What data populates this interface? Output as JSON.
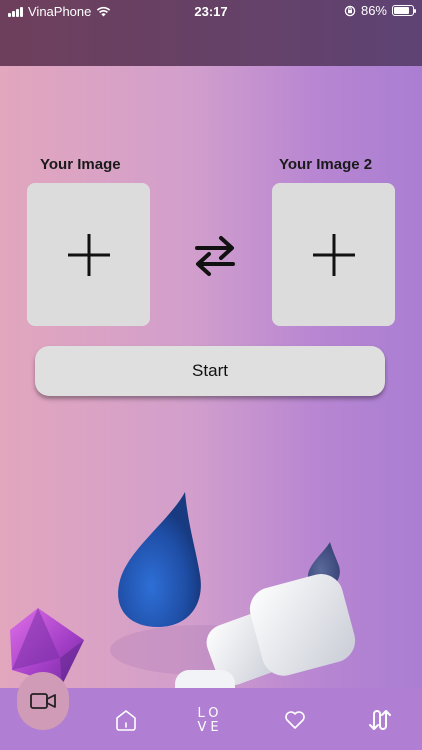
{
  "status_bar": {
    "carrier": "VinaPhone",
    "time": "23:17",
    "battery_percent": "86%",
    "battery_level": 0.86
  },
  "picker": {
    "label_left": "Your Image",
    "label_right": "Your Image 2",
    "start_label": "Start"
  },
  "bottom_nav": {
    "items": [
      {
        "icon": "video-camera-icon",
        "active": true
      },
      {
        "icon": "home-icon",
        "active": false
      },
      {
        "icon": "love-text-icon",
        "text_line1": "LO",
        "text_line2": "VE",
        "active": false
      },
      {
        "icon": "heart-icon",
        "active": false
      },
      {
        "icon": "swap-arrows-icon",
        "active": false
      }
    ]
  },
  "colors": {
    "background_left": "#e2a6bd",
    "background_right": "#aa7ed3",
    "header": "#664166",
    "slot": "#dddcdc",
    "nav": "#b07fd3"
  }
}
